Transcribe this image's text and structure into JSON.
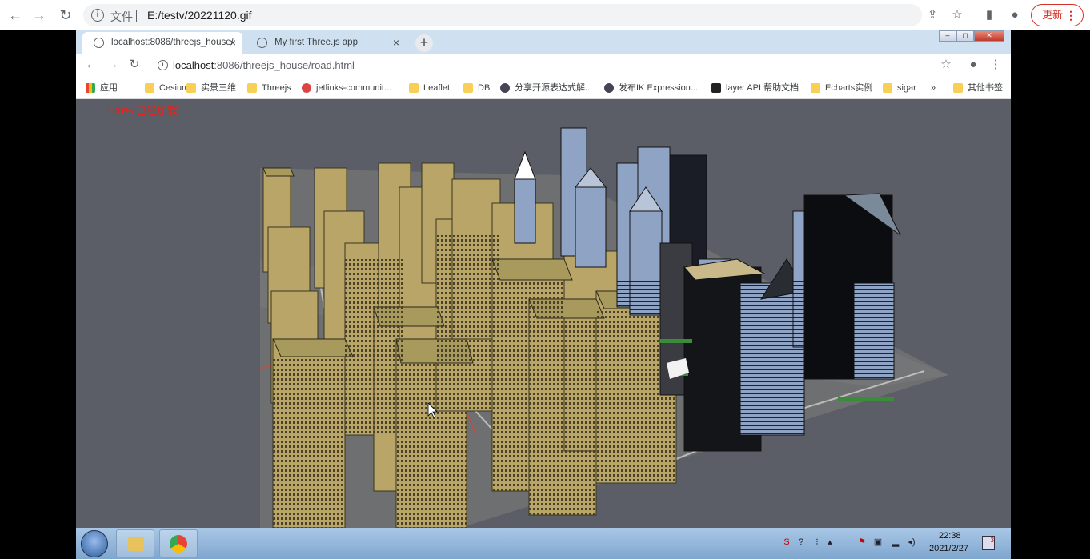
{
  "outer": {
    "info_icon_label": "i",
    "scheme": "文件",
    "url": "E:/testv/20221120.gif",
    "update_label": "更新",
    "menu_dots": "⋮"
  },
  "tabs": [
    {
      "title": "localhost:8086/threejs_house/",
      "close": "×"
    },
    {
      "title": "My first Three.js app",
      "close": "×"
    }
  ],
  "newtab": "+",
  "winctl": {
    "min": "‒",
    "max": "◻",
    "close": "✕"
  },
  "inner": {
    "info_icon_label": "i",
    "host": "localhost",
    "path": ":8086/threejs_house/road.html"
  },
  "bookmarks": [
    {
      "label": "应用",
      "icon": "apps"
    },
    {
      "label": "Cesium",
      "icon": "folder"
    },
    {
      "label": "实景三维",
      "icon": "folder"
    },
    {
      "label": "Threejs",
      "icon": "folder"
    },
    {
      "label": "jetlinks-communit...",
      "icon": "red"
    },
    {
      "label": "Leaflet",
      "icon": "folder"
    },
    {
      "label": "DB",
      "icon": "folder"
    },
    {
      "label": "分享开源表达式解...",
      "icon": "cap"
    },
    {
      "label": "发布IK Expression...",
      "icon": "cap"
    },
    {
      "label": "layer API 帮助文档",
      "icon": "lay"
    },
    {
      "label": "Echarts实例",
      "icon": "folder"
    },
    {
      "label": "sigar",
      "icon": "folder"
    },
    {
      "label": "»",
      "icon": ""
    },
    {
      "label": "其他书签",
      "icon": "folder"
    }
  ],
  "status": {
    "loaded": "100% 已经加载"
  },
  "taskbar": {
    "time": "22:38",
    "date": "2021/2/27",
    "notify_count": "3"
  },
  "colors": {
    "scene_bg": "#5b5e66",
    "building": "#b8a567",
    "roof": "#a89a5c"
  }
}
